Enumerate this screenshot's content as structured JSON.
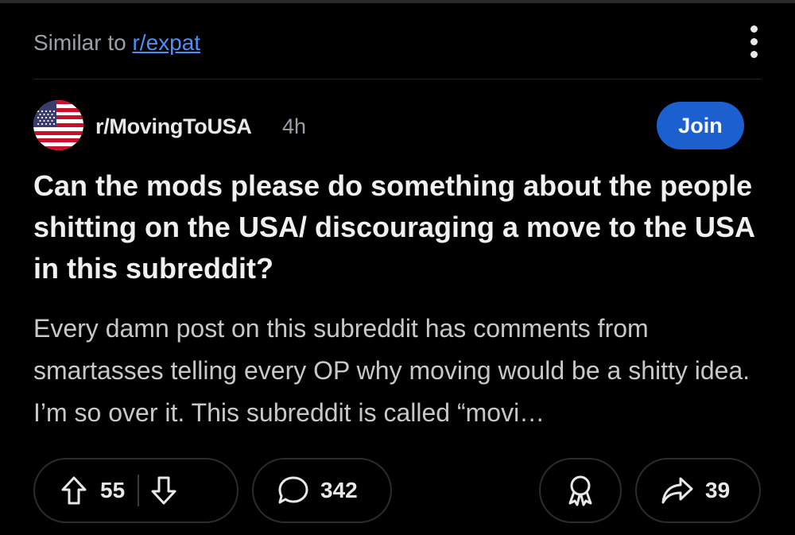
{
  "feed": {
    "similar_prefix": "Similar to ",
    "similar_link": "r/expat"
  },
  "post": {
    "subreddit": "r/MovingToUSA",
    "age": "4h",
    "join_label": "Join",
    "title": "Can the mods please do something about the people shitting on the USA/ discouraging a move to the USA in this subreddit?",
    "body": "Every damn post on this subreddit has comments from smartasses telling every OP why moving would be a shitty idea. I’m so over it. This subreddit is called “movi…",
    "upvotes": "55",
    "comments": "342",
    "shares": "39"
  },
  "colors": {
    "background": "#000000",
    "link": "#4f8ef7",
    "join_button": "#1c5fcf",
    "muted_text": "#9aa0a6"
  },
  "icons": [
    "kebab-menu-icon",
    "us-flag-avatar",
    "upvote-icon",
    "downvote-icon",
    "comment-icon",
    "award-icon",
    "share-icon"
  ]
}
